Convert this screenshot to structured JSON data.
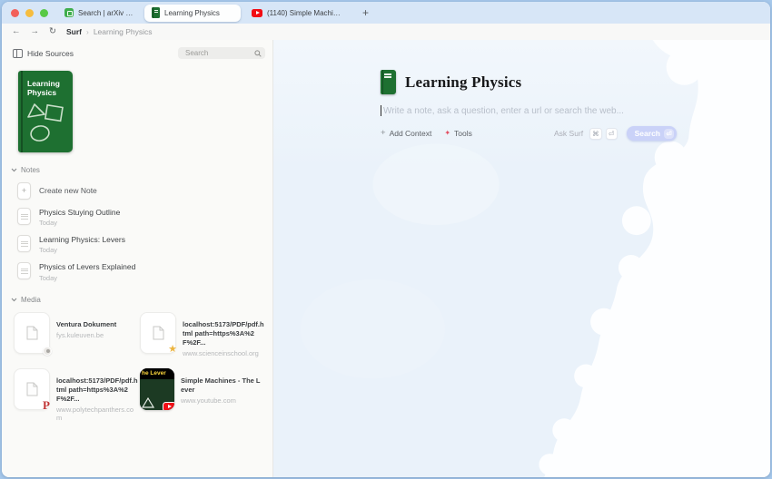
{
  "tab_bar": {
    "tabs": [
      {
        "label": "Search | arXiv e-print repo...",
        "icon": "arxiv-favicon",
        "active": false
      },
      {
        "label": "Learning Physics",
        "icon": "green-book",
        "active": true
      },
      {
        "label": "(1140) Simple Machines - T...",
        "icon": "youtube",
        "active": false
      }
    ],
    "new_tab_label": "+"
  },
  "nav_bar": {
    "back_glyph": "←",
    "forward_glyph": "→",
    "refresh_glyph": "↻",
    "breadcrumb": {
      "app": "Surf",
      "separator": "›",
      "page": "Learning Physics"
    }
  },
  "sidebar": {
    "hide_sources_label": "Hide Sources",
    "search": {
      "placeholder": "Search"
    },
    "source_book": {
      "title": "Learning Physics"
    },
    "notes": {
      "header": "Notes",
      "create_label": "Create new Note",
      "create_icon": "+",
      "items": [
        {
          "title": "Physics Stuying Outline",
          "date": "Today"
        },
        {
          "title": "Learning Physics: Levers",
          "date": "Today"
        },
        {
          "title": "Physics of Levers Explained",
          "date": "Today"
        }
      ]
    },
    "media": {
      "header": "Media",
      "items": [
        {
          "title": "Ventura Dokument",
          "domain": "fys.kuleuven.be",
          "badge": "favicon"
        },
        {
          "title": "localhost:5173/PDF/pdf.html path=https%3A%2F%2F...",
          "domain": "www.scienceinschool.org",
          "badge": "star",
          "badge_glyph": "★"
        },
        {
          "title": "localhost:5173/PDF/pdf.html path=https%3A%2F%2F...",
          "domain": "www.polytechpanthers.com",
          "badge": "letter",
          "badge_letter": "P"
        },
        {
          "title": "Simple Machines - The Lever",
          "domain": "www.youtube.com",
          "badge": "youtube-play",
          "thumb_text": "he Lever"
        }
      ]
    }
  },
  "main": {
    "title": "Learning Physics",
    "prompt": {
      "placeholder": "Write a note, ask a question, enter a url or search the web..."
    },
    "add_context_plus": "+",
    "add_context_label": "Add Context",
    "tools_glyph": "✦",
    "tools_label": "Tools",
    "ask_surf_label": "Ask Surf",
    "keys": {
      "cmd": "⌘",
      "enter": "⏎"
    },
    "search_button": {
      "label": "Search",
      "key": "⏎"
    }
  },
  "colors": {
    "book_green": "#1e7031",
    "tab_strip_blue": "#d7e6f7",
    "sky_blue": "#eaf2fa",
    "search_button_lavender": "#cad2f8",
    "youtube_red": "#f20d14",
    "star_gold": "#ecb43e",
    "p_badge_red": "#c03434",
    "tools_pink": "#e34d5f"
  }
}
